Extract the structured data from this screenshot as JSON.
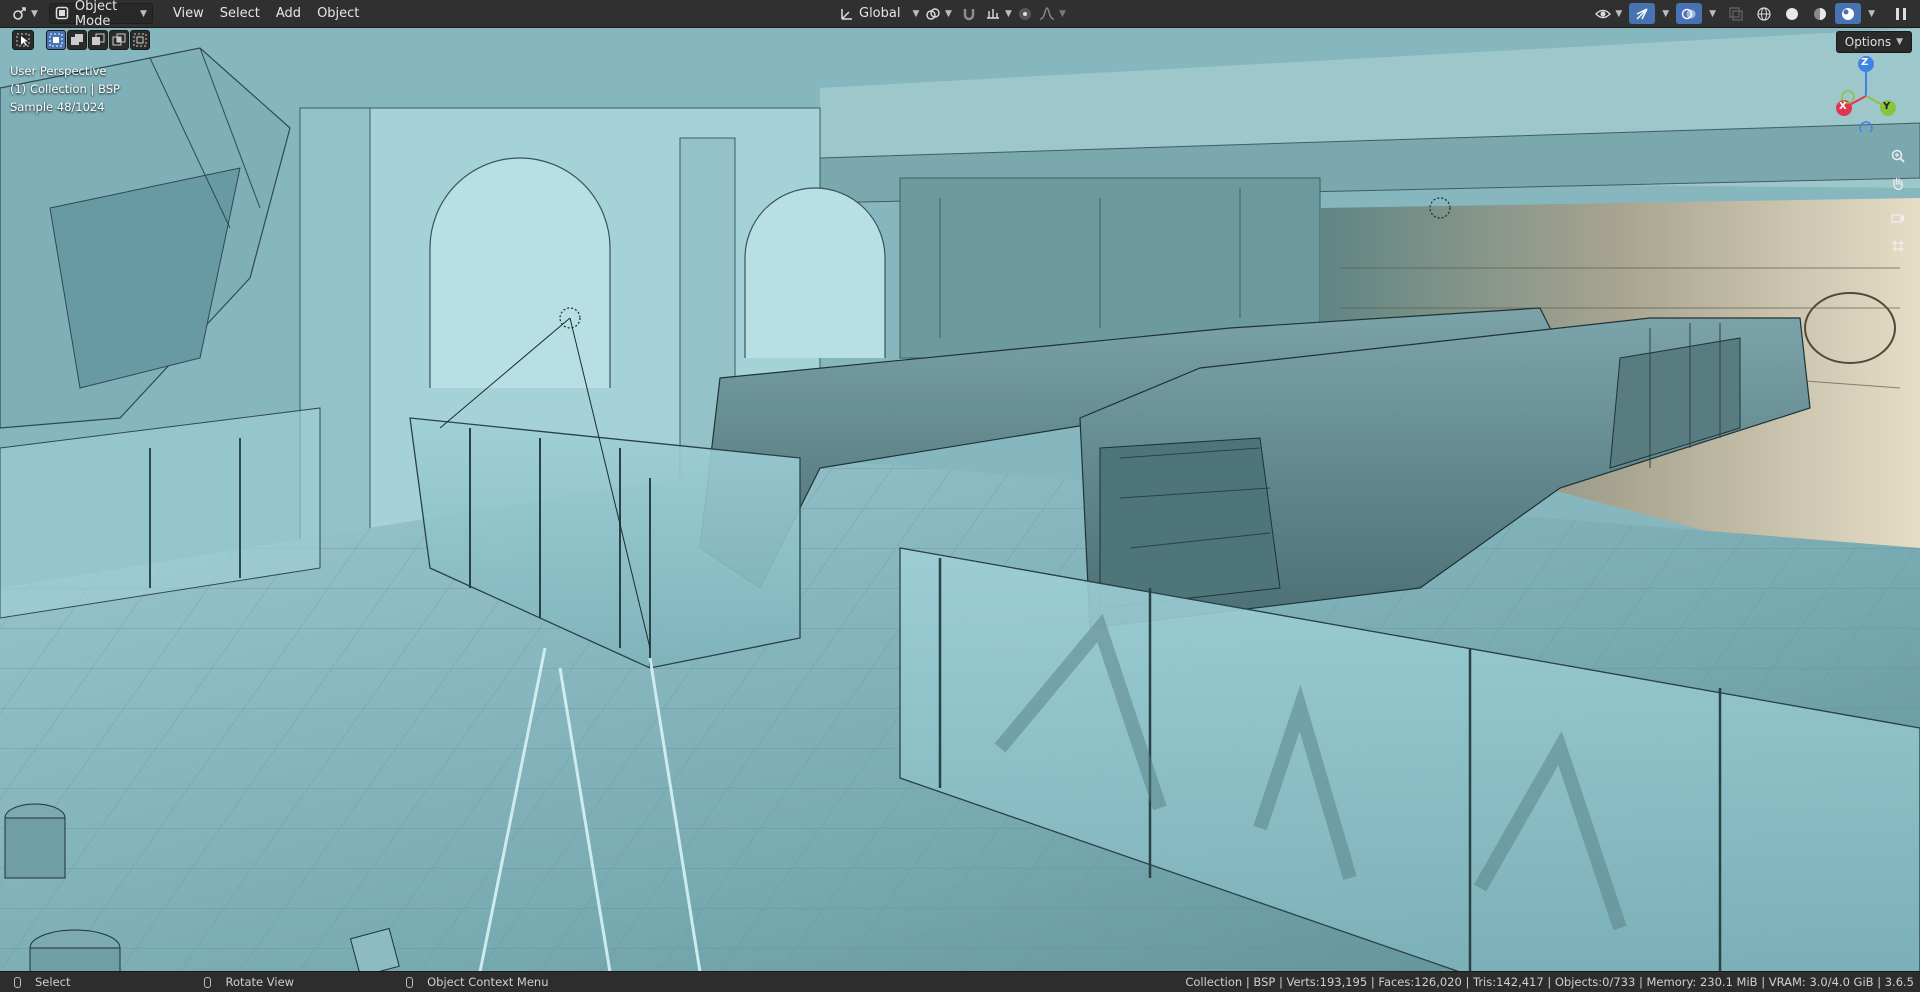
{
  "header": {
    "editor_type_icon": "3d-viewport-icon",
    "mode": {
      "label": "Object Mode",
      "icon": "object-mode-icon"
    },
    "menus": [
      "View",
      "Select",
      "Add",
      "Object"
    ],
    "transform_orientation": {
      "label": "Global",
      "icon": "transform-orientation-icon"
    },
    "right_icons": [
      "visibility-icon",
      "gizmo-icon",
      "overlay-icon",
      "xray-icon",
      "wireframe-shading-icon",
      "solid-shading-icon",
      "material-shading-icon",
      "rendered-shading-icon",
      "pause-icon"
    ]
  },
  "toolbar": {
    "tools": [
      "select-tool-icon"
    ],
    "selection_modes": [
      "new-selection-icon",
      "extend-selection-icon",
      "subtract-selection-icon",
      "invert-selection-icon",
      "intersect-selection-icon"
    ]
  },
  "viewport": {
    "info_lines": [
      "User Perspective",
      "(1) Collection | BSP",
      "Sample 48/1024"
    ],
    "options_label": "Options",
    "gizmo": {
      "x": "X",
      "y": "Y",
      "z": "Z"
    },
    "nav_icons": [
      "zoom-icon",
      "pan-hand-icon",
      "camera-icon",
      "grid-icon"
    ],
    "colors": {
      "x_axis": "#e0344f",
      "y_axis": "#8ac43c",
      "z_axis": "#3e84e6"
    }
  },
  "statusbar": {
    "select_label": "Select",
    "rotate_label": "Rotate View",
    "context_menu_label": "Object Context Menu",
    "stats": "Collection | BSP | Verts:193,195 | Faces:126,020 | Tris:142,417 | Objects:0/733 | Memory: 230.1 MiB | VRAM: 3.0/4.0 GiB | 3.6.5"
  }
}
